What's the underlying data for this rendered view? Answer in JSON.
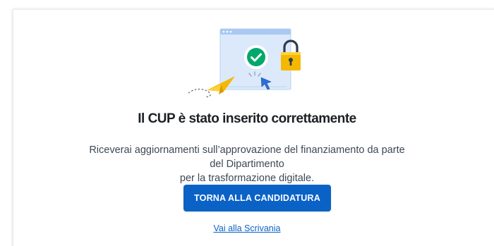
{
  "confirmation": {
    "title": "Il CUP è stato inserito correttamente",
    "description_line1": "Riceverai aggiornamenti sull’approvazione del finanziamento da parte del Dipartimento",
    "description_line2": "per la trasformazione digitale.",
    "primary_button_label": "TORNA ALLA CANDIDATURA",
    "secondary_link_label": "Vai alla Scrivania"
  },
  "icons": {
    "illustration": "success-browser-illustration",
    "check": "check-circle-icon",
    "lock": "padlock-icon",
    "paper_plane": "paper-plane-icon",
    "cursor": "cursor-icon"
  },
  "colors": {
    "primary": "#0b62c6",
    "success": "#00a86b",
    "lock": "#f5b800",
    "window": "#dbe9fb",
    "title_text": "#1c2024",
    "body_text": "#3d4855"
  }
}
